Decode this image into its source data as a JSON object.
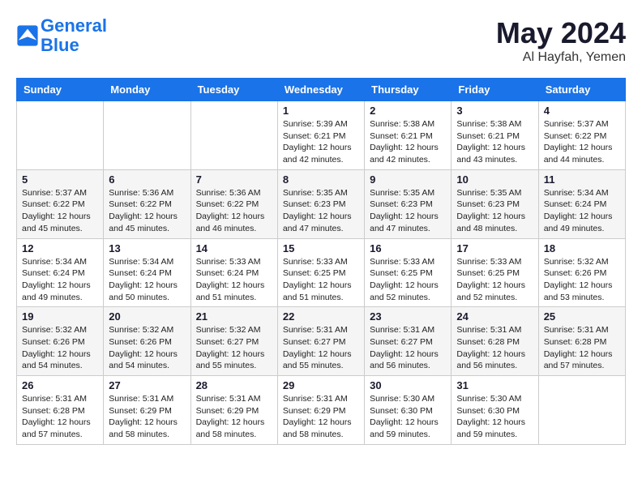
{
  "header": {
    "logo_line1": "General",
    "logo_line2": "Blue",
    "month_year": "May 2024",
    "location": "Al Hayfah, Yemen"
  },
  "days_of_week": [
    "Sunday",
    "Monday",
    "Tuesday",
    "Wednesday",
    "Thursday",
    "Friday",
    "Saturday"
  ],
  "weeks": [
    [
      {
        "day": "",
        "info": ""
      },
      {
        "day": "",
        "info": ""
      },
      {
        "day": "",
        "info": ""
      },
      {
        "day": "1",
        "info": "Sunrise: 5:39 AM\nSunset: 6:21 PM\nDaylight: 12 hours\nand 42 minutes."
      },
      {
        "day": "2",
        "info": "Sunrise: 5:38 AM\nSunset: 6:21 PM\nDaylight: 12 hours\nand 42 minutes."
      },
      {
        "day": "3",
        "info": "Sunrise: 5:38 AM\nSunset: 6:21 PM\nDaylight: 12 hours\nand 43 minutes."
      },
      {
        "day": "4",
        "info": "Sunrise: 5:37 AM\nSunset: 6:22 PM\nDaylight: 12 hours\nand 44 minutes."
      }
    ],
    [
      {
        "day": "5",
        "info": "Sunrise: 5:37 AM\nSunset: 6:22 PM\nDaylight: 12 hours\nand 45 minutes."
      },
      {
        "day": "6",
        "info": "Sunrise: 5:36 AM\nSunset: 6:22 PM\nDaylight: 12 hours\nand 45 minutes."
      },
      {
        "day": "7",
        "info": "Sunrise: 5:36 AM\nSunset: 6:22 PM\nDaylight: 12 hours\nand 46 minutes."
      },
      {
        "day": "8",
        "info": "Sunrise: 5:35 AM\nSunset: 6:23 PM\nDaylight: 12 hours\nand 47 minutes."
      },
      {
        "day": "9",
        "info": "Sunrise: 5:35 AM\nSunset: 6:23 PM\nDaylight: 12 hours\nand 47 minutes."
      },
      {
        "day": "10",
        "info": "Sunrise: 5:35 AM\nSunset: 6:23 PM\nDaylight: 12 hours\nand 48 minutes."
      },
      {
        "day": "11",
        "info": "Sunrise: 5:34 AM\nSunset: 6:24 PM\nDaylight: 12 hours\nand 49 minutes."
      }
    ],
    [
      {
        "day": "12",
        "info": "Sunrise: 5:34 AM\nSunset: 6:24 PM\nDaylight: 12 hours\nand 49 minutes."
      },
      {
        "day": "13",
        "info": "Sunrise: 5:34 AM\nSunset: 6:24 PM\nDaylight: 12 hours\nand 50 minutes."
      },
      {
        "day": "14",
        "info": "Sunrise: 5:33 AM\nSunset: 6:24 PM\nDaylight: 12 hours\nand 51 minutes."
      },
      {
        "day": "15",
        "info": "Sunrise: 5:33 AM\nSunset: 6:25 PM\nDaylight: 12 hours\nand 51 minutes."
      },
      {
        "day": "16",
        "info": "Sunrise: 5:33 AM\nSunset: 6:25 PM\nDaylight: 12 hours\nand 52 minutes."
      },
      {
        "day": "17",
        "info": "Sunrise: 5:33 AM\nSunset: 6:25 PM\nDaylight: 12 hours\nand 52 minutes."
      },
      {
        "day": "18",
        "info": "Sunrise: 5:32 AM\nSunset: 6:26 PM\nDaylight: 12 hours\nand 53 minutes."
      }
    ],
    [
      {
        "day": "19",
        "info": "Sunrise: 5:32 AM\nSunset: 6:26 PM\nDaylight: 12 hours\nand 54 minutes."
      },
      {
        "day": "20",
        "info": "Sunrise: 5:32 AM\nSunset: 6:26 PM\nDaylight: 12 hours\nand 54 minutes."
      },
      {
        "day": "21",
        "info": "Sunrise: 5:32 AM\nSunset: 6:27 PM\nDaylight: 12 hours\nand 55 minutes."
      },
      {
        "day": "22",
        "info": "Sunrise: 5:31 AM\nSunset: 6:27 PM\nDaylight: 12 hours\nand 55 minutes."
      },
      {
        "day": "23",
        "info": "Sunrise: 5:31 AM\nSunset: 6:27 PM\nDaylight: 12 hours\nand 56 minutes."
      },
      {
        "day": "24",
        "info": "Sunrise: 5:31 AM\nSunset: 6:28 PM\nDaylight: 12 hours\nand 56 minutes."
      },
      {
        "day": "25",
        "info": "Sunrise: 5:31 AM\nSunset: 6:28 PM\nDaylight: 12 hours\nand 57 minutes."
      }
    ],
    [
      {
        "day": "26",
        "info": "Sunrise: 5:31 AM\nSunset: 6:28 PM\nDaylight: 12 hours\nand 57 minutes."
      },
      {
        "day": "27",
        "info": "Sunrise: 5:31 AM\nSunset: 6:29 PM\nDaylight: 12 hours\nand 58 minutes."
      },
      {
        "day": "28",
        "info": "Sunrise: 5:31 AM\nSunset: 6:29 PM\nDaylight: 12 hours\nand 58 minutes."
      },
      {
        "day": "29",
        "info": "Sunrise: 5:31 AM\nSunset: 6:29 PM\nDaylight: 12 hours\nand 58 minutes."
      },
      {
        "day": "30",
        "info": "Sunrise: 5:30 AM\nSunset: 6:30 PM\nDaylight: 12 hours\nand 59 minutes."
      },
      {
        "day": "31",
        "info": "Sunrise: 5:30 AM\nSunset: 6:30 PM\nDaylight: 12 hours\nand 59 minutes."
      },
      {
        "day": "",
        "info": ""
      }
    ]
  ]
}
